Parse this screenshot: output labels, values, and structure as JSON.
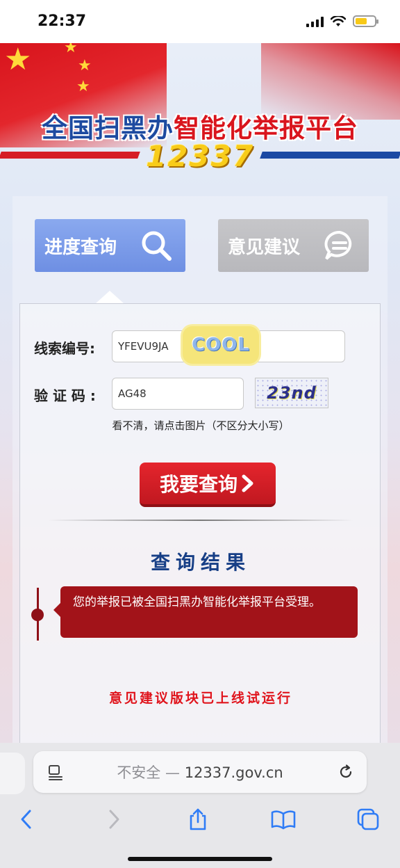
{
  "status_bar": {
    "time": "22:37",
    "icons": [
      "cellular-signal-icon",
      "wifi-icon",
      "battery-icon"
    ],
    "battery_color": "#f7c918"
  },
  "banner": {
    "title_part1": "全国扫黑办",
    "title_part2": "智能化举报平台",
    "number": "12337",
    "colors": {
      "blue": "#1d4aa0",
      "red": "#d9151d",
      "gold": "#f8cc1a"
    }
  },
  "tabs": [
    {
      "label": "进度查询",
      "icon": "search-icon",
      "active": true
    },
    {
      "label": "意见建议",
      "icon": "chat-bubble-icon",
      "active": false
    }
  ],
  "form": {
    "clue_label": "线索编号:",
    "clue_value": "YFEVU9JA",
    "sticker_text": "COOL",
    "captcha_label": "验 证 码 :",
    "captcha_value": "AG48",
    "captcha_image_text": "23nd",
    "hint": "看不清，请点击图片（不区分大小写）",
    "submit_label": "我要查询"
  },
  "result": {
    "title": "查询结果",
    "message": "您的举报已被全国扫黑办智能化举报平台受理。"
  },
  "notice": "意见建议版块已上线试运行",
  "browser": {
    "security_label": "不安全 —",
    "domain": "12337.gov.cn",
    "toolbar_icons": [
      "back-icon",
      "forward-icon",
      "share-icon",
      "bookmarks-icon",
      "tabs-icon"
    ]
  }
}
